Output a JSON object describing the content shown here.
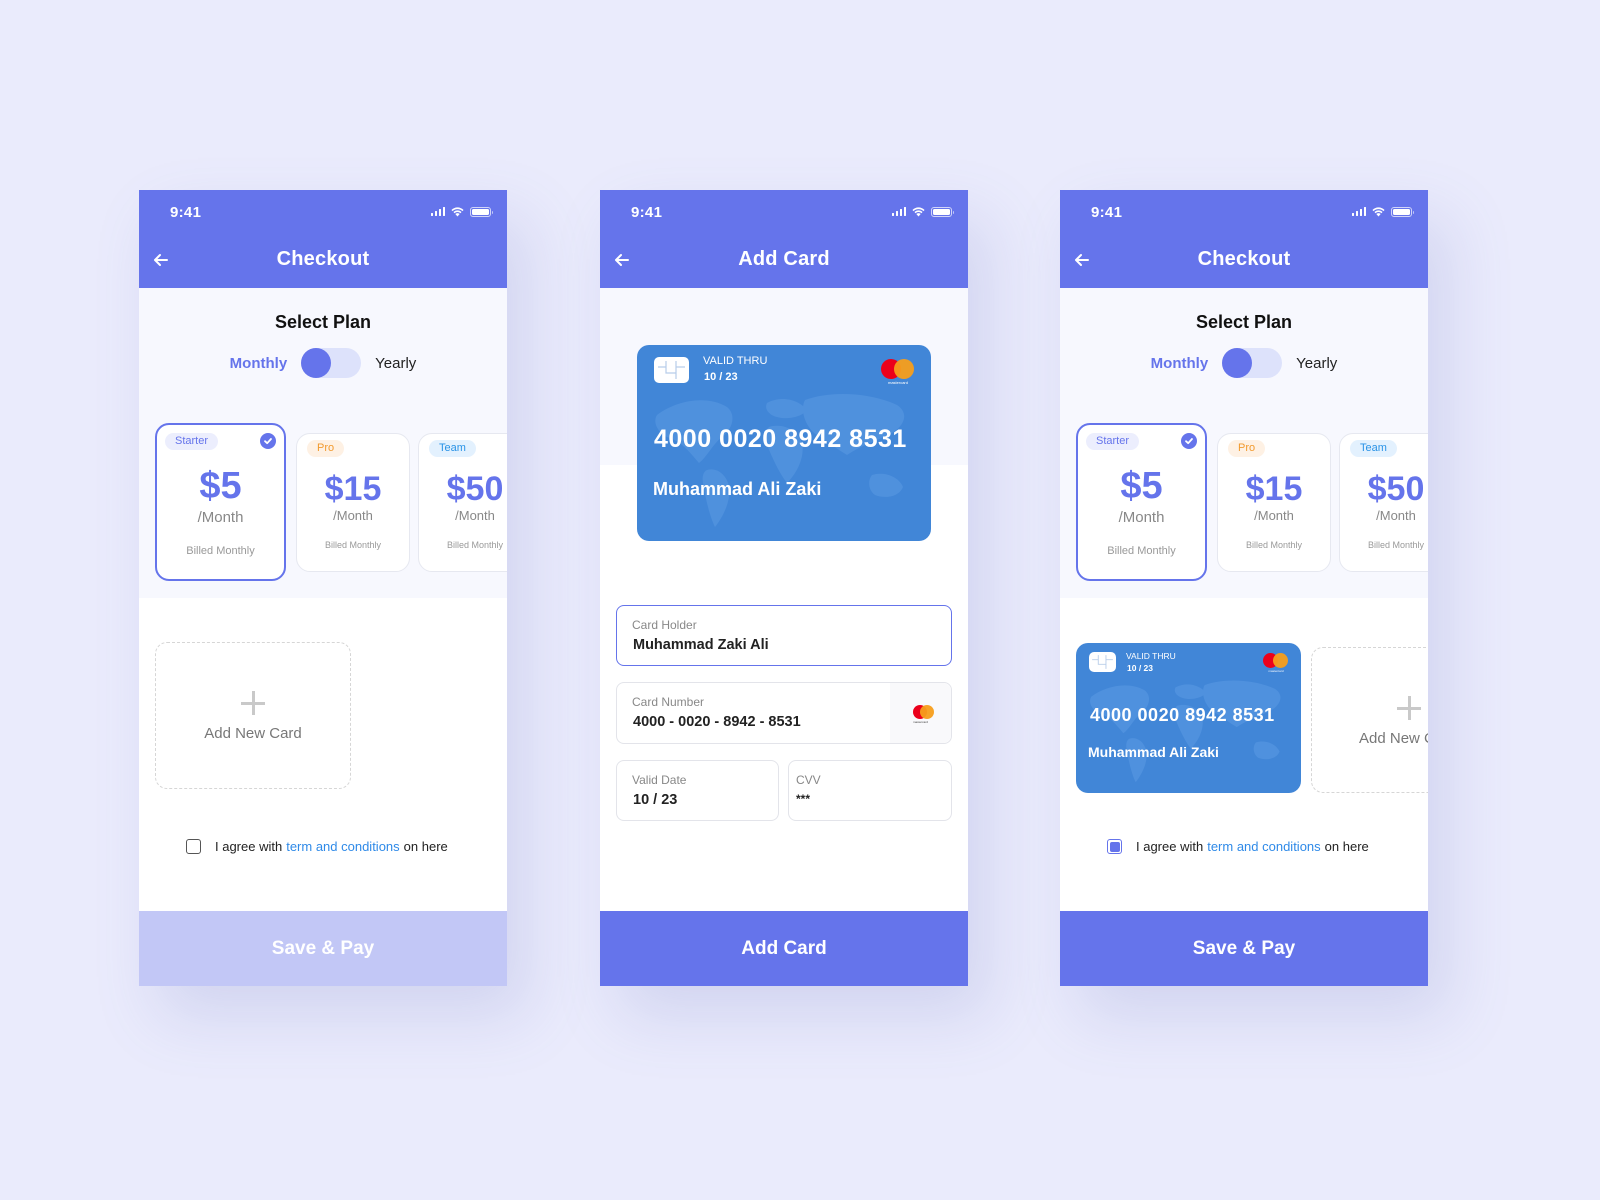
{
  "colors": {
    "background": "#eaebfc",
    "primary": "#6574eb",
    "primary_disabled": "#c2c7f6",
    "card_blue": "#4186d7",
    "link": "#2f8ae8",
    "badge_pro": "#f29a2e",
    "badge_team": "#2a93e6"
  },
  "status_bar": {
    "time": "9:41",
    "icons": [
      "signal-icon",
      "wifi-icon",
      "battery-icon"
    ]
  },
  "screens": [
    {
      "title": "Checkout",
      "back_icon": "arrow-left-icon",
      "select_plan_title": "Select Plan",
      "billing_toggle": {
        "left_label": "Monthly",
        "right_label": "Yearly",
        "selected": "Monthly"
      },
      "plans": [
        {
          "badge": "Starter",
          "price": "$5",
          "period": "/Month",
          "billed": "Billed Monthly",
          "selected": true
        },
        {
          "badge": "Pro",
          "price": "$15",
          "period": "/Month",
          "billed": "Billed Monthly",
          "selected": false
        },
        {
          "badge": "Team",
          "price": "$50",
          "period": "/Month",
          "billed": "Billed Monthly",
          "selected": false
        }
      ],
      "add_new_card_label": "Add New Card",
      "agree": {
        "prefix": "I agree with",
        "link": "term and conditions",
        "suffix": "on here",
        "checked": false
      },
      "primary_button": "Save & Pay",
      "primary_button_enabled": false
    },
    {
      "title": "Add Card",
      "back_icon": "arrow-left-icon",
      "card_preview": {
        "valid_thru_label": "VALID THRU",
        "valid_thru": "10 / 23",
        "number": "4000 0020 8942 8531",
        "holder": "Muhammad Ali Zaki",
        "brand": "mastercard"
      },
      "form": {
        "card_holder": {
          "label": "Card Holder",
          "value": "Muhammad Zaki Ali"
        },
        "card_number": {
          "label": "Card Number",
          "value": "4000 - 0020 - 8942 - 8531"
        },
        "valid_date": {
          "label": "Valid Date",
          "value": "10 / 23"
        },
        "cvv": {
          "label": "CVV",
          "value": "***"
        }
      },
      "primary_button": "Add Card",
      "primary_button_enabled": true
    },
    {
      "title": "Checkout",
      "back_icon": "arrow-left-icon",
      "select_plan_title": "Select Plan",
      "billing_toggle": {
        "left_label": "Monthly",
        "right_label": "Yearly",
        "selected": "Monthly"
      },
      "plans": [
        {
          "badge": "Starter",
          "price": "$5",
          "period": "/Month",
          "billed": "Billed Monthly",
          "selected": true
        },
        {
          "badge": "Pro",
          "price": "$15",
          "period": "/Month",
          "billed": "Billed Monthly",
          "selected": false
        },
        {
          "badge": "Team",
          "price": "$50",
          "period": "/Month",
          "billed": "Billed Monthly",
          "selected": false
        }
      ],
      "saved_card": {
        "valid_thru_label": "VALID THRU",
        "valid_thru": "10 / 23",
        "number": "4000 0020 8942 8531",
        "holder": "Muhammad Ali Zaki",
        "brand": "mastercard"
      },
      "add_new_card_label": "Add New Card",
      "agree": {
        "prefix": "I agree with",
        "link": "term and conditions",
        "suffix": "on here",
        "checked": true
      },
      "primary_button": "Save & Pay",
      "primary_button_enabled": true
    }
  ]
}
